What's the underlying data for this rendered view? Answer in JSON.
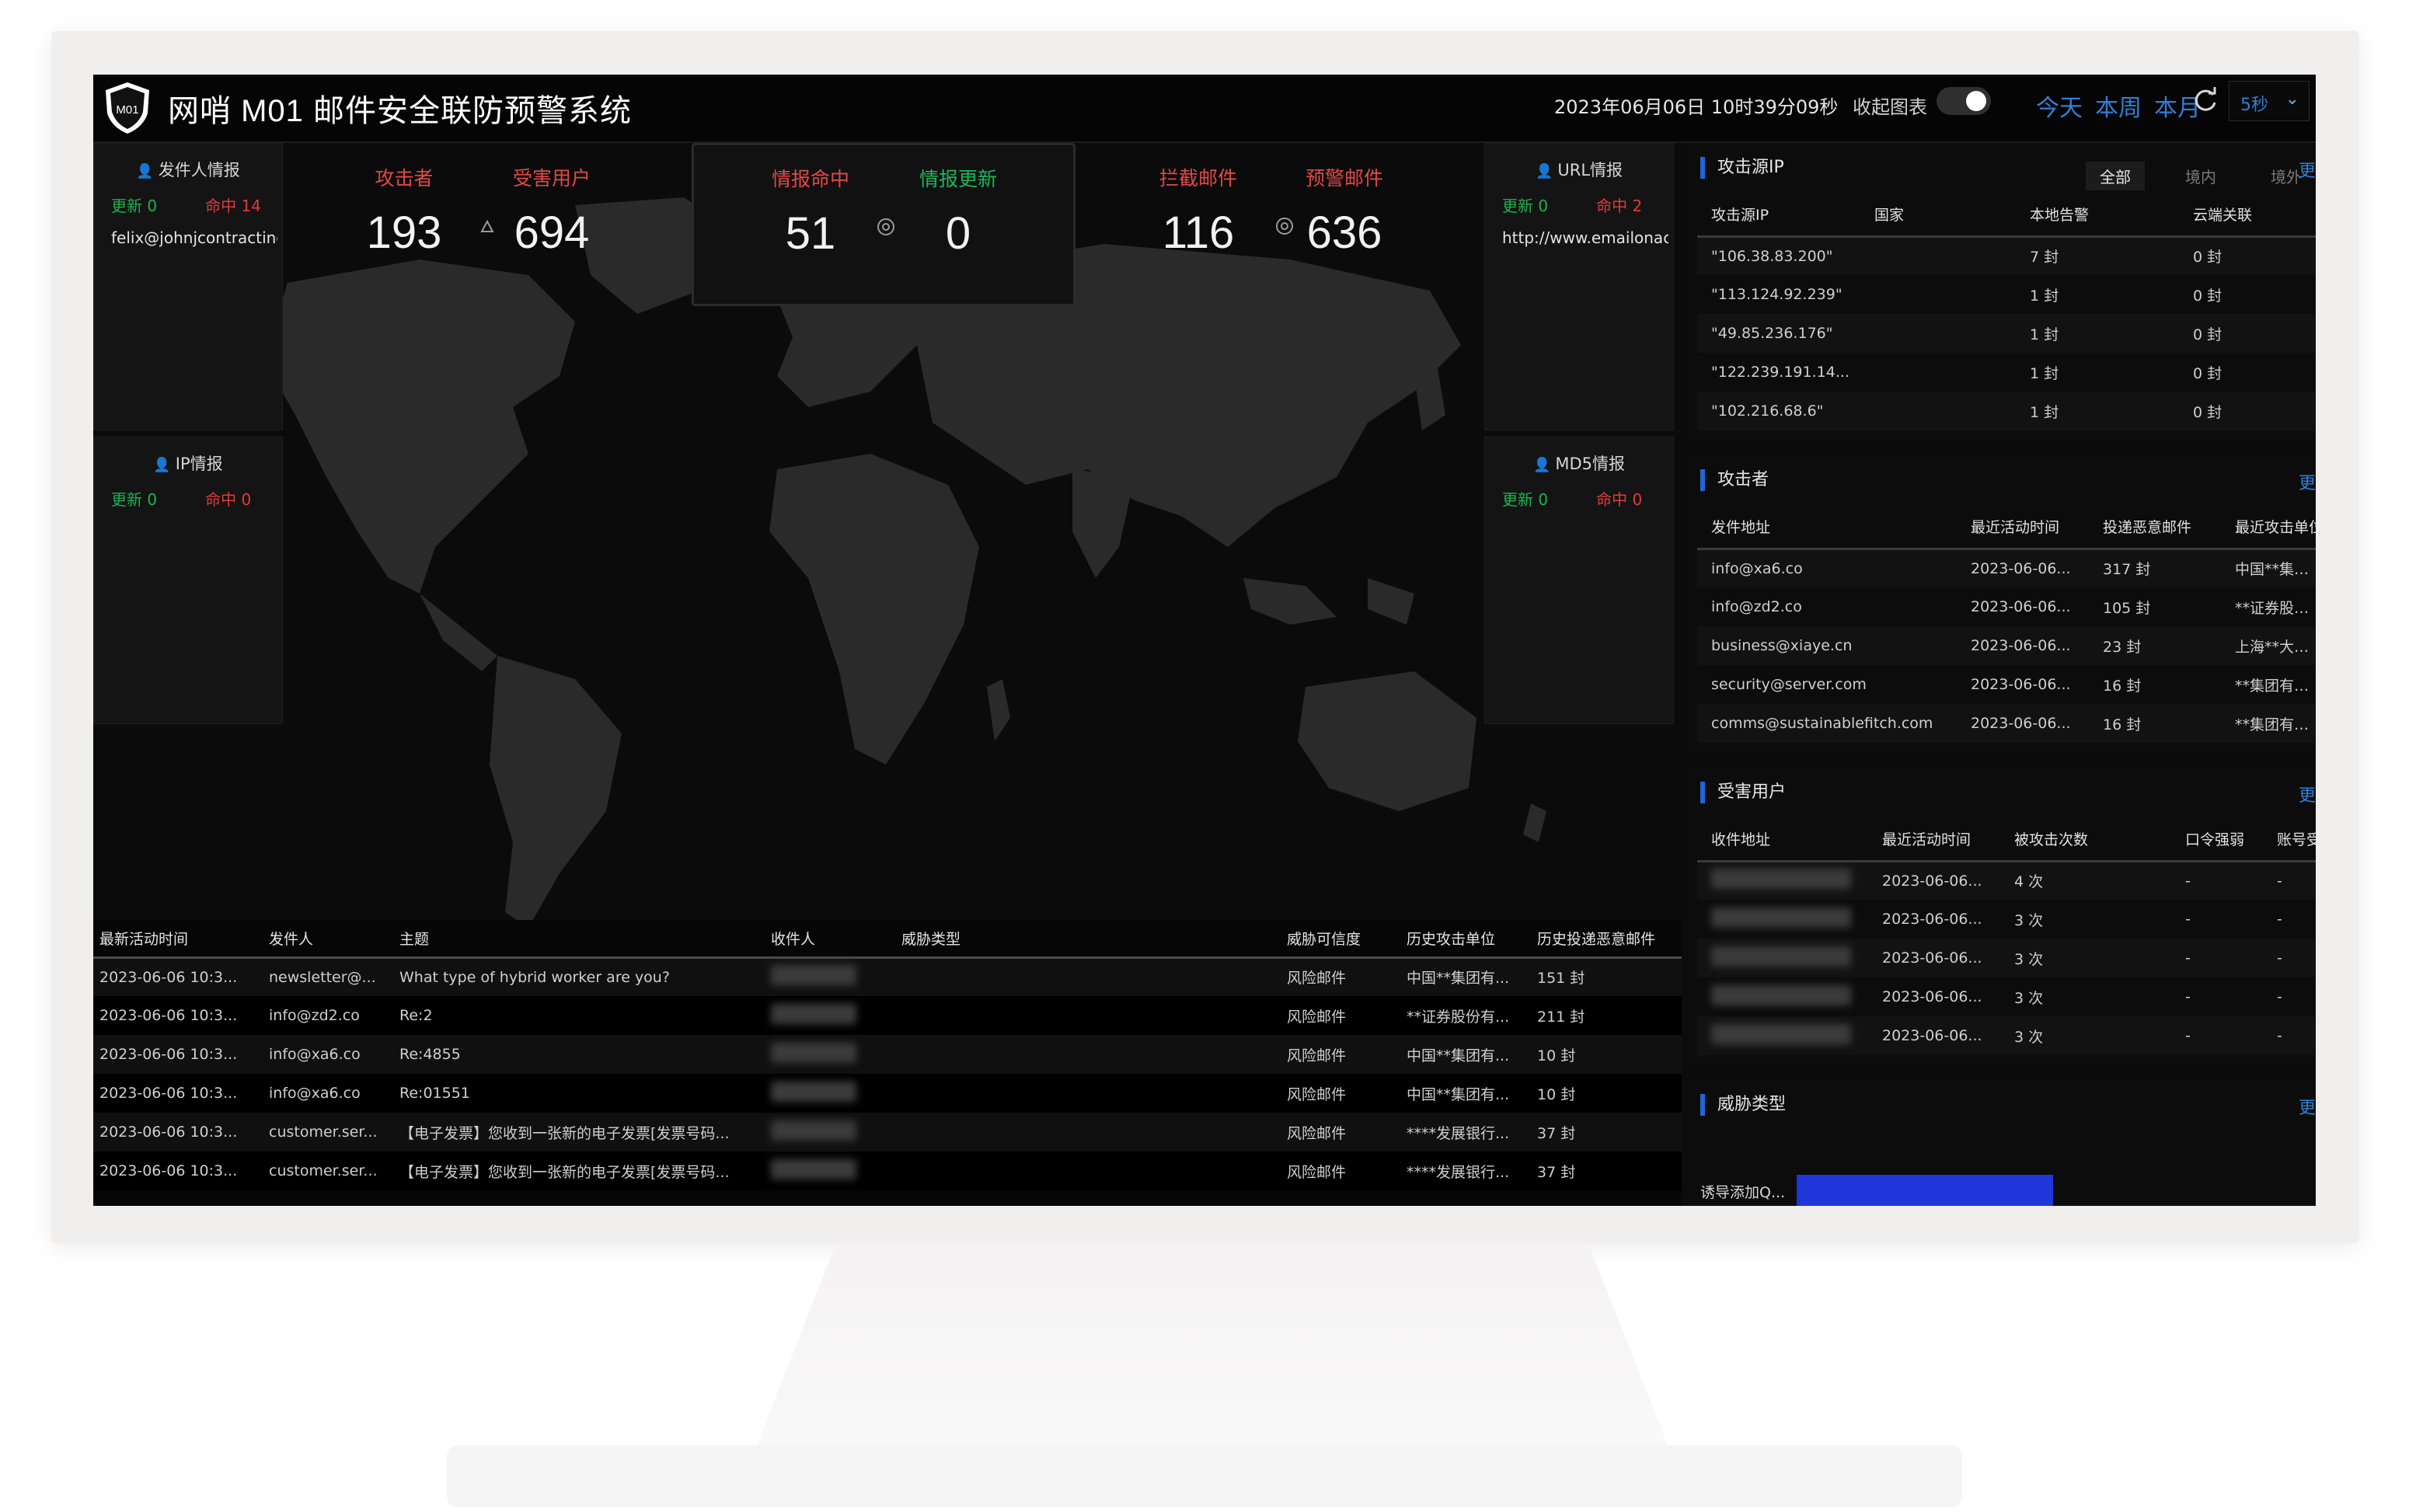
{
  "header": {
    "logo_text": "M01",
    "title": "网哨 M01  邮件安全联防预警系统",
    "datetime": "2023年06月06日 10时39分09秒",
    "collapse_label": "收起图表",
    "range_tabs": [
      "今天",
      "本周",
      "本月"
    ],
    "interval": "5秒"
  },
  "side_cards": {
    "sender": {
      "title": "发件人情报",
      "update": "更新 0",
      "hit": "命中 14",
      "value": "felix@johnjcontracting"
    },
    "url": {
      "title": "URL情报",
      "update": "更新 0",
      "hit": "命中 2",
      "value": "http://www.emailonaco"
    },
    "ip": {
      "title": "IP情报",
      "update": "更新 0",
      "hit": "命中 0"
    },
    "md5": {
      "title": "MD5情报",
      "update": "更新 0",
      "hit": "命中 0"
    }
  },
  "stats": {
    "attackers": {
      "label": "攻击者",
      "value": "193"
    },
    "victims": {
      "label": "受害用户",
      "value": "694"
    },
    "intel_hit": {
      "label": "情报命中",
      "value": "51"
    },
    "intel_update": {
      "label": "情报更新",
      "value": "0"
    },
    "blocked": {
      "label": "拦截邮件",
      "value": "116"
    },
    "warning": {
      "label": "预警邮件",
      "value": "636"
    }
  },
  "source_ip": {
    "title": "攻击源IP",
    "more": "更",
    "tabs": [
      "全部",
      "境内",
      "境外"
    ],
    "columns": [
      "攻击源IP",
      "国家",
      "本地告警",
      "云端关联"
    ],
    "rows": [
      [
        "\"106.38.83.200\"",
        "",
        "7 封",
        "0 封"
      ],
      [
        "\"113.124.92.239\"",
        "",
        "1 封",
        "0 封"
      ],
      [
        "\"49.85.236.176\"",
        "",
        "1 封",
        "0 封"
      ],
      [
        "\"122.239.191.14...",
        "",
        "1 封",
        "0 封"
      ],
      [
        "\"102.216.68.6\"",
        "",
        "1 封",
        "0 封"
      ]
    ]
  },
  "attackers_panel": {
    "title": "攻击者",
    "more": "更",
    "columns": [
      "发件地址",
      "最近活动时间",
      "投递恶意邮件",
      "最近攻击单位"
    ],
    "rows": [
      [
        "info@xa6.co",
        "2023-06-06...",
        "317 封",
        "中国**集团有..."
      ],
      [
        "info@zd2.co",
        "2023-06-06...",
        "105 封",
        "**证券股份有..."
      ],
      [
        "business@xiaye.cn",
        "2023-06-06...",
        "23 封",
        "上海**大学，..."
      ],
      [
        "security@server.com",
        "2023-06-06...",
        "16 封",
        "**集团有限公..."
      ],
      [
        "comms@sustainablefitch.com",
        "2023-06-06...",
        "16 封",
        "**集团有限公..."
      ]
    ]
  },
  "victims_panel": {
    "title": "受害用户",
    "more": "更",
    "columns": [
      "收件地址",
      "最近活动时间",
      "被攻击次数",
      "口令强弱",
      "账号受控"
    ],
    "rows": [
      [
        "",
        "2023-06-06...",
        "4 次",
        "-",
        "-"
      ],
      [
        "",
        "2023-06-06...",
        "3 次",
        "-",
        "-"
      ],
      [
        "",
        "2023-06-06...",
        "3 次",
        "-",
        "-"
      ],
      [
        "",
        "2023-06-06...",
        "3 次",
        "-",
        "-"
      ],
      [
        "",
        "2023-06-06...",
        "3 次",
        "-",
        "-"
      ]
    ]
  },
  "threat_panel": {
    "title": "威胁类型",
    "more": "更",
    "bar_label": "诱导添加Q...",
    "bar_value_pct": 100
  },
  "events": {
    "columns": [
      "最新活动时间",
      "发件人",
      "主题",
      "收件人",
      "威胁类型",
      "威胁可信度",
      "历史攻击单位",
      "历史投递恶意邮件"
    ],
    "rows": [
      [
        "2023-06-06 10:3...",
        "newsletter@...",
        "What type of hybrid worker are you?",
        "",
        "",
        "风险邮件",
        "中国**集团有...",
        "151 封"
      ],
      [
        "2023-06-06 10:3...",
        "info@zd2.co",
        "Re:2",
        "",
        "",
        "风险邮件",
        "**证券股份有...",
        "211 封"
      ],
      [
        "2023-06-06 10:3...",
        "info@xa6.co",
        "Re:4855",
        "",
        "",
        "风险邮件",
        "中国**集团有...",
        "10 封"
      ],
      [
        "2023-06-06 10:3...",
        "info@xa6.co",
        "Re:01551",
        "",
        "",
        "风险邮件",
        "中国**集团有...",
        "10 封"
      ],
      [
        "2023-06-06 10:3...",
        "customer.ser...",
        "【电子发票】您收到一张新的电子发票[发票号码...",
        "",
        "",
        "风险邮件",
        "****发展银行...",
        "37 封"
      ],
      [
        "2023-06-06 10:3...",
        "customer.ser...",
        "【电子发票】您收到一张新的电子发票[发票号码...",
        "",
        "",
        "风险邮件",
        "****发展银行...",
        "37 封"
      ]
    ]
  },
  "colors": {
    "accent": "#2e7fd8",
    "update": "#1db24f",
    "hit": "#e03a3a",
    "bar": "#1f36d8"
  }
}
